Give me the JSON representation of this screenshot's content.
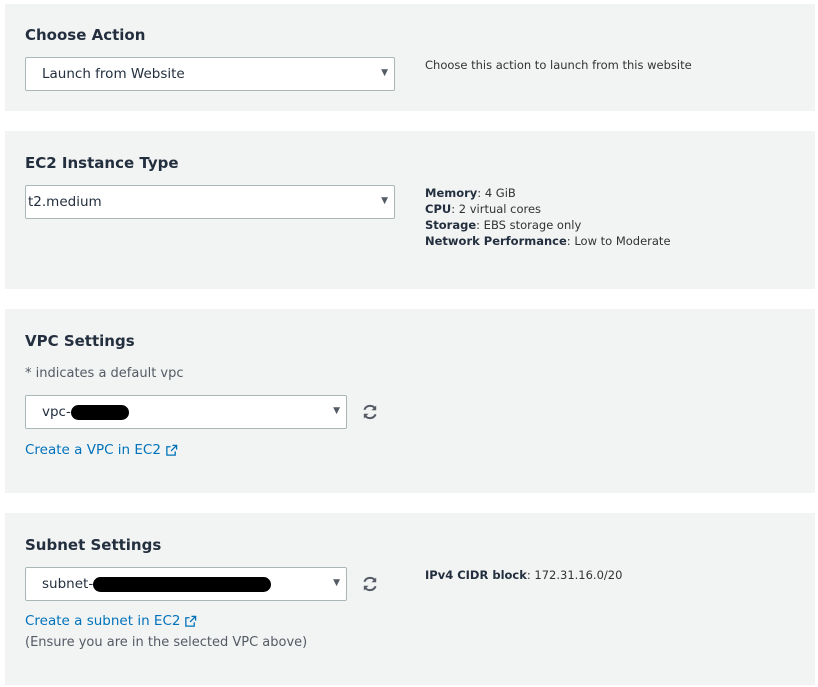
{
  "action": {
    "title": "Choose Action",
    "selected": "Launch from Website",
    "description": "Choose this action to launch from this website"
  },
  "ec2": {
    "title": "EC2 Instance Type",
    "selected": "t2.medium",
    "specs": [
      {
        "label": "Memory",
        "value": ": 4 GiB"
      },
      {
        "label": "CPU",
        "value": ": 2 virtual cores"
      },
      {
        "label": "Storage",
        "value": ": EBS storage only"
      },
      {
        "label": "Network Performance",
        "value": ": Low to Moderate"
      }
    ]
  },
  "vpc": {
    "title": "VPC Settings",
    "hint": "* indicates a default vpc",
    "selected_prefix": "vpc-",
    "create_link": "Create a VPC in EC2"
  },
  "subnet": {
    "title": "Subnet Settings",
    "selected_prefix": "subnet-",
    "create_link": "Create a subnet in EC2",
    "note": "(Ensure you are in the selected VPC above)",
    "cidr_label": "IPv4 CIDR block",
    "cidr_value": ": 172.31.16.0/20"
  },
  "icons": {
    "caret": "caret-down-icon",
    "refresh": "refresh-icon",
    "external": "external-link-icon"
  },
  "colors": {
    "panel_bg": "#f2f3f3",
    "link": "#0073bb",
    "heading": "#232f3e"
  }
}
